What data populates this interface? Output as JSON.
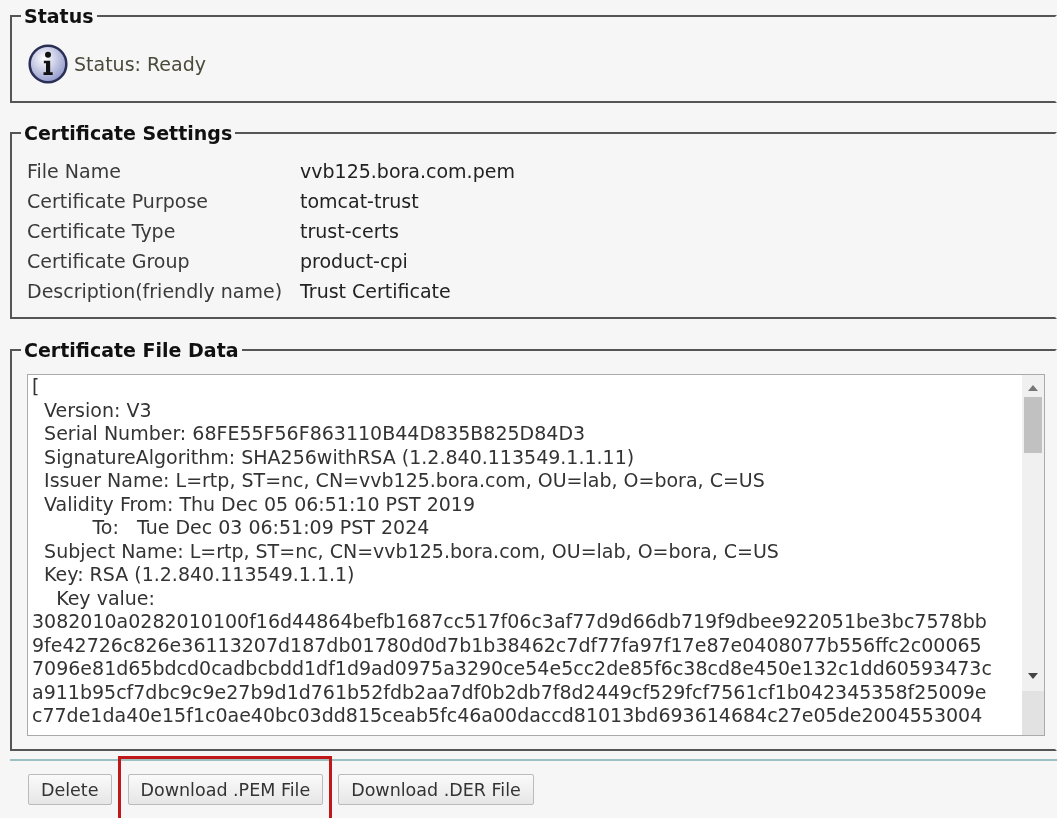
{
  "status": {
    "title": "Status",
    "message": "Status: Ready"
  },
  "settings": {
    "title": "Certificate Settings",
    "rows": [
      {
        "label": "File Name",
        "value": "vvb125.bora.com.pem"
      },
      {
        "label": "Certificate Purpose",
        "value": "tomcat-trust"
      },
      {
        "label": "Certificate Type",
        "value": "trust-certs"
      },
      {
        "label": "Certificate Group",
        "value": "product-cpi"
      },
      {
        "label": "Description(friendly name)",
        "value": "Trust Certificate"
      }
    ]
  },
  "file_data": {
    "title": "Certificate File Data",
    "lines": [
      "[",
      "  Version: V3",
      "  Serial Number: 68FE55F56F863110B44D835B825D84D3",
      "  SignatureAlgorithm: SHA256withRSA (1.2.840.113549.1.1.11)",
      "  Issuer Name: L=rtp, ST=nc, CN=vvb125.bora.com, OU=lab, O=bora, C=US",
      "  Validity From: Thu Dec 05 06:51:10 PST 2019",
      "          To:   Tue Dec 03 06:51:09 PST 2024",
      "  Subject Name: L=rtp, ST=nc, CN=vvb125.bora.com, OU=lab, O=bora, C=US",
      "  Key: RSA (1.2.840.113549.1.1.1)",
      "    Key value:",
      "3082010a0282010100f16d44864befb1687cc517f06c3af77d9d66db719f9dbee922051be3bc7578bb",
      "9fe42726c826e36113207d187db01780d0d7b1b38462c7df77fa97f17e87e0408077b556ffc2c00065",
      "7096e81d65bdcd0cadbcbdd1df1d9ad0975a3290ce54e5cc2de85f6c38cd8e450e132c1dd60593473c",
      "a911b95cf7dbc9c9e27b9d1d761b52fdb2aa7df0b2db7f8d2449cf529fcf7561cf1b042345358f25009e",
      "c77de1da40e15f1c0ae40bc03dd815ceab5fc46a00daccd81013bd693614684c27e05de2004553004"
    ]
  },
  "buttons": [
    {
      "label": "Delete",
      "highlighted": false
    },
    {
      "label": "Download .PEM File",
      "highlighted": true
    },
    {
      "label": "Download .DER File",
      "highlighted": false
    }
  ]
}
